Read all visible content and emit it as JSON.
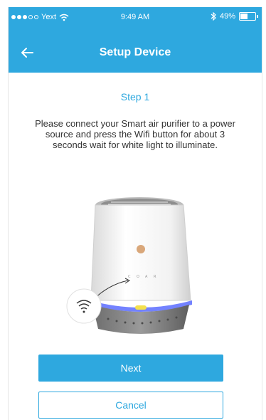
{
  "status_bar": {
    "carrier": "Yext",
    "time": "9:49 AM",
    "battery_percent": "49%",
    "battery_level": 0.49,
    "signal_icon": "signal-dots-icon",
    "wifi_icon": "wifi-icon",
    "bluetooth_icon": "bluetooth-icon"
  },
  "nav": {
    "title": "Setup Device",
    "back_icon": "arrow-left-icon"
  },
  "step": {
    "title": "Step 1",
    "instructions": "Please connect your Smart air purifier to a power source and press the Wifi button for about 3 seconds wait for white light to illuminate."
  },
  "illustration": {
    "icon": "air-purifier-illustration",
    "callout_icon": "wifi-button-icon"
  },
  "buttons": {
    "next": "Next",
    "cancel": "Cancel"
  },
  "colors": {
    "accent": "#2ea8df",
    "text": "#333333",
    "led_blue": "#5b6cff",
    "led_yellow": "#f4e04d"
  }
}
